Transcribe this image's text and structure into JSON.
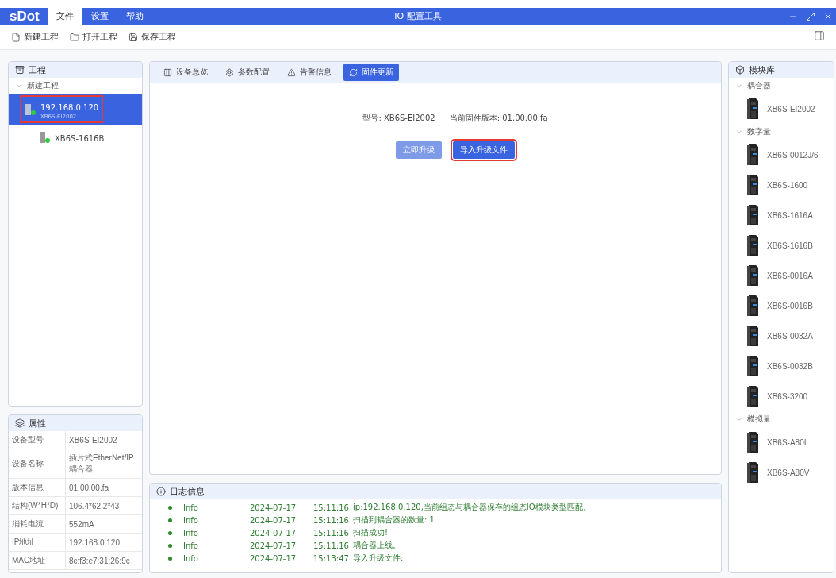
{
  "app": {
    "logo": "sDot",
    "title": "IO 配置工具"
  },
  "menu": [
    {
      "label": "文件",
      "selected": true
    },
    {
      "label": "设置",
      "selected": false
    },
    {
      "label": "帮助",
      "selected": false
    }
  ],
  "toolbar": [
    {
      "label": "新建工程",
      "kind": "file"
    },
    {
      "label": "打开工程",
      "kind": "folder"
    },
    {
      "label": "保存工程",
      "kind": "save"
    }
  ],
  "project": {
    "title": "工程",
    "root": {
      "label": "新建工程",
      "expanded": true,
      "children": [
        {
          "label": "192.168.0.120",
          "sublabel": "XB6S-EI2002",
          "selected": true,
          "highlighted": true,
          "children": [
            {
              "label": "XB6S-1616B",
              "selected": false,
              "highlighted": false
            }
          ]
        }
      ]
    }
  },
  "properties": {
    "title": "属性",
    "rows": [
      {
        "name": "设备型号",
        "value": "XB6S-EI2002"
      },
      {
        "name": "设备名称",
        "value": "插片式EtherNet/IP耦合器"
      },
      {
        "name": "版本信息",
        "value": "01.00.00.fa"
      },
      {
        "name": "结构(W*H*D)",
        "value": "106.4*62.2*43"
      },
      {
        "name": "消耗电流",
        "value": "552mA"
      },
      {
        "name": "IP地址",
        "value": "192.168.0.120"
      },
      {
        "name": "MAC地址",
        "value": "8c:f3:e7:31:26:9c"
      }
    ]
  },
  "tabs": [
    {
      "label": "设备总览",
      "kind": "grid",
      "selected": false
    },
    {
      "label": "参数配置",
      "kind": "gear",
      "selected": false
    },
    {
      "label": "告警信息",
      "kind": "warning",
      "selected": false
    },
    {
      "label": "固件更新",
      "kind": "refresh",
      "selected": true
    }
  ],
  "firmware": {
    "model": "型号: XB6S-EI2002",
    "version": "当前固件版本: 01.00.00.fa",
    "buttons": [
      {
        "label": "立即升级",
        "disabled": true,
        "highlighted": false
      },
      {
        "label": "导入升级文件",
        "disabled": false,
        "highlighted": true
      }
    ]
  },
  "log": {
    "title": "日志信息",
    "rows": [
      {
        "level": "Info",
        "date": "2024-07-17",
        "time": "15:11:16",
        "message": "ip:192.168.0.120,当前组态与耦合器保存的组态IO模块类型匹配。"
      },
      {
        "level": "Info",
        "date": "2024-07-17",
        "time": "15:11:16",
        "message": "扫描到耦合器的数量:  1"
      },
      {
        "level": "Info",
        "date": "2024-07-17",
        "time": "15:11:16",
        "message": "扫描成功!"
      },
      {
        "level": "Info",
        "date": "2024-07-17",
        "time": "15:11:16",
        "message": "耦合器上线。"
      },
      {
        "level": "Info",
        "date": "2024-07-17",
        "time": "15:13:47",
        "message": "导入升级文件:"
      }
    ]
  },
  "library": {
    "title": "模块库",
    "groups": [
      {
        "label": "耦合器",
        "expanded": true,
        "items": [
          "XB6S-EI2002"
        ]
      },
      {
        "label": "数字量",
        "expanded": true,
        "items": [
          "XB6S-0012J/6",
          "XB6S-1600",
          "XB6S-1616A",
          "XB6S-1616B",
          "XB6S-0016A",
          "XB6S-0016B",
          "XB6S-0032A",
          "XB6S-0032B",
          "XB6S-3200"
        ]
      },
      {
        "label": "模拟量",
        "expanded": true,
        "items": [
          "XB6S-A80I",
          "XB6S-A80V"
        ]
      }
    ]
  }
}
